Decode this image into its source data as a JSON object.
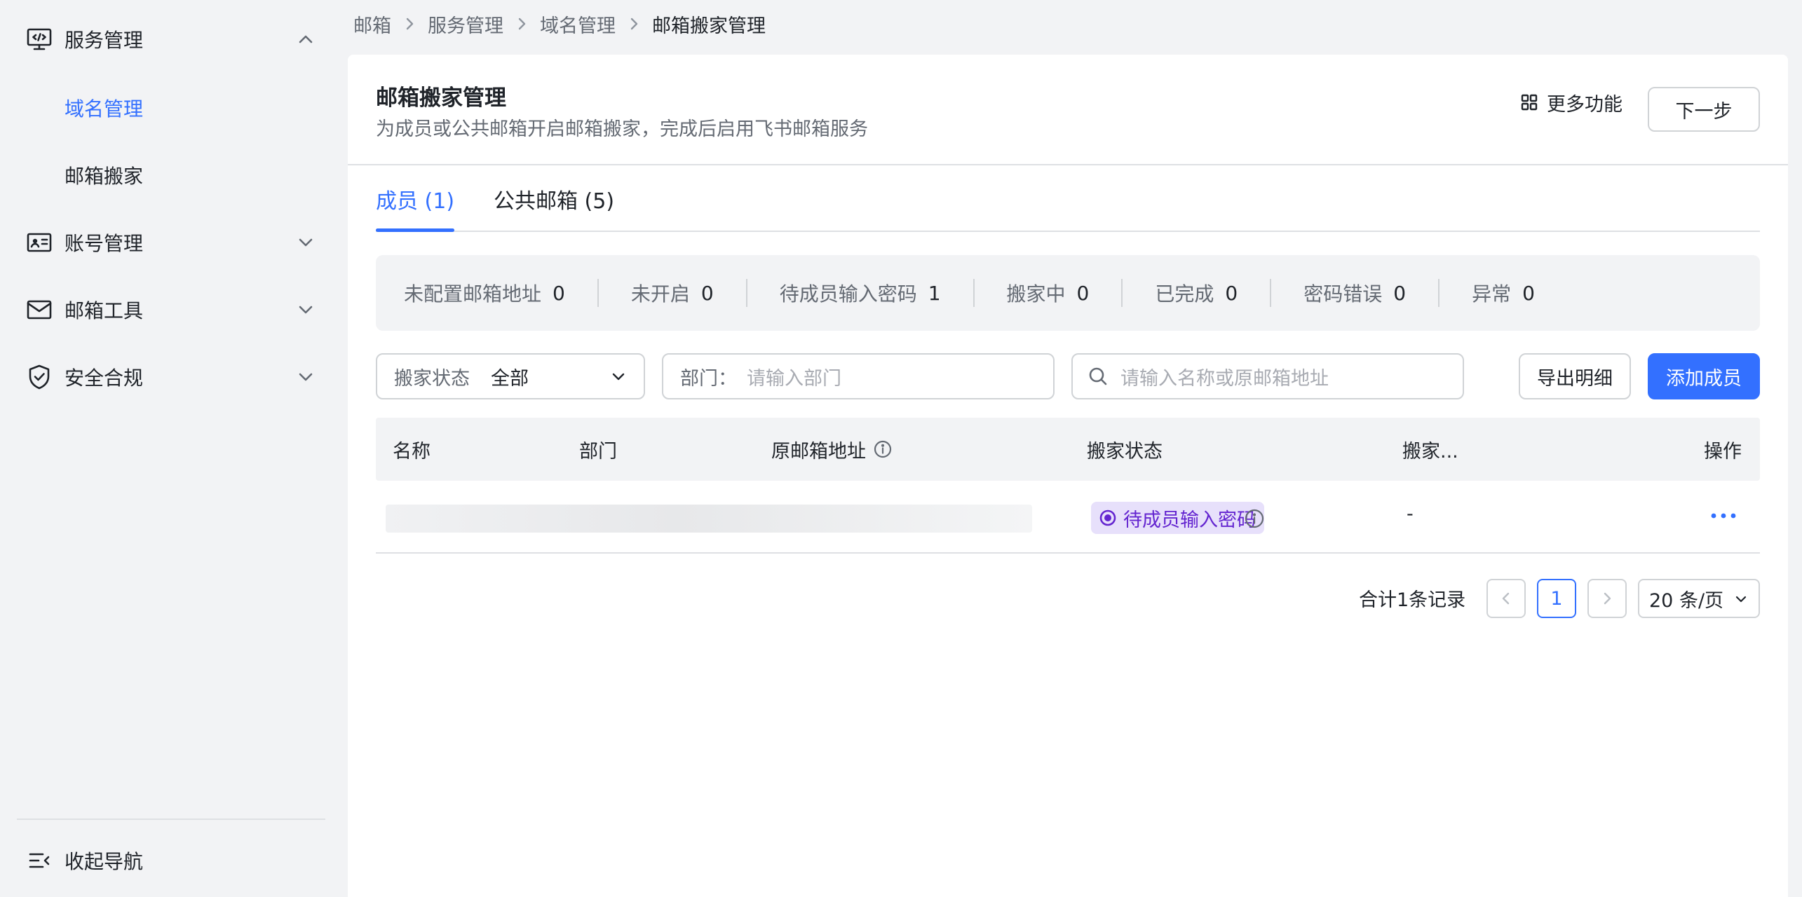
{
  "sidebar": {
    "groups": [
      {
        "label": "服务管理",
        "icon": "monitor-code-icon",
        "expanded": true
      },
      {
        "label": "账号管理",
        "icon": "id-card-icon",
        "expanded": false
      },
      {
        "label": "邮箱工具",
        "icon": "mail-icon",
        "expanded": false
      },
      {
        "label": "安全合规",
        "icon": "shield-check-icon",
        "expanded": false
      }
    ],
    "sub_items": [
      {
        "label": "域名管理",
        "active": true
      },
      {
        "label": "邮箱搬家",
        "active": false
      }
    ],
    "collapse_label": "收起导航"
  },
  "breadcrumb": [
    "邮箱",
    "服务管理",
    "域名管理",
    "邮箱搬家管理"
  ],
  "header": {
    "title": "邮箱搬家管理",
    "description": "为成员或公共邮箱开启邮箱搬家，完成后启用飞书邮箱服务",
    "more_label": "更多功能",
    "next_label": "下一步"
  },
  "tabs": [
    {
      "label": "成员 (1)",
      "active": true
    },
    {
      "label": "公共邮箱 (5)",
      "active": false
    }
  ],
  "stats": [
    {
      "label": "未配置邮箱地址",
      "value": "0"
    },
    {
      "label": "未开启",
      "value": "0"
    },
    {
      "label": "待成员输入密码",
      "value": "1"
    },
    {
      "label": "搬家中",
      "value": "0"
    },
    {
      "label": "已完成",
      "value": "0"
    },
    {
      "label": "密码错误",
      "value": "0"
    },
    {
      "label": "异常",
      "value": "0"
    }
  ],
  "filters": {
    "status_prefix": "搬家状态",
    "status_value": "全部",
    "dept_prefix": "部门：",
    "dept_placeholder": "请输入部门",
    "search_placeholder": "请输入名称或原邮箱地址"
  },
  "actions": {
    "export_label": "导出明细",
    "add_label": "添加成员"
  },
  "table": {
    "columns": [
      "名称",
      "部门",
      "原邮箱地址",
      "搬家状态",
      "搬家...",
      "操作"
    ],
    "rows": [
      {
        "status": "待成员输入密码",
        "migration": "-"
      }
    ]
  },
  "pagination": {
    "total_label": "合计1条记录",
    "current_page": "1",
    "page_size": "20 条/页"
  },
  "colors": {
    "accent": "#3370ff",
    "status_tag_bg": "#e7e0fb",
    "status_tag_text": "#6425d0"
  }
}
